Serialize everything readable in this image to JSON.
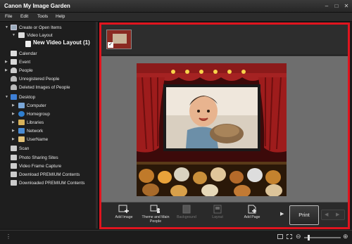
{
  "app": {
    "title": "Canon My Image Garden"
  },
  "window_controls": {
    "minimize": "–",
    "maximize": "□",
    "close": "✕"
  },
  "menu": [
    "File",
    "Edit",
    "Tools",
    "Help"
  ],
  "sidebar": {
    "items": [
      {
        "label": "Create or Open Items",
        "expanded": true,
        "icon": "create-icon"
      },
      {
        "label": "Video Layout",
        "expanded": true,
        "icon": "video-layout-icon"
      },
      {
        "label": "New Video Layout (1)",
        "selected": true,
        "icon": "document-icon"
      },
      {
        "label": "Calendar",
        "icon": "calendar-icon"
      },
      {
        "label": "Event",
        "icon": "event-icon"
      },
      {
        "label": "People",
        "icon": "people-icon"
      },
      {
        "label": "Unregistered People",
        "icon": "unregistered-people-icon"
      },
      {
        "label": "Deleted Images of People",
        "icon": "deleted-people-icon"
      },
      {
        "label": "Desktop",
        "expanded": true,
        "icon": "desktop-icon"
      },
      {
        "label": "Computer",
        "icon": "computer-icon"
      },
      {
        "label": "Homegroup",
        "icon": "homegroup-icon"
      },
      {
        "label": "Libraries",
        "icon": "libraries-icon"
      },
      {
        "label": "Network",
        "icon": "network-icon"
      },
      {
        "label": "UserName",
        "icon": "user-folder-icon"
      },
      {
        "label": "Scan",
        "icon": "scan-icon"
      },
      {
        "label": "Photo Sharing Sites",
        "icon": "photo-sharing-icon"
      },
      {
        "label": "Video Frame Capture",
        "icon": "video-frame-icon"
      },
      {
        "label": "Download PREMIUM Contents",
        "icon": "download-icon"
      },
      {
        "label": "Downloaded PREMIUM Contents",
        "icon": "downloaded-icon"
      }
    ]
  },
  "thumbnail": {
    "checked": true,
    "check_glyph": "✓"
  },
  "toolbar": {
    "add_image": "Add Image",
    "theme": "Theme and Main People",
    "background": "Background",
    "layout": "Layout",
    "add_page": "Add Page",
    "print": "Print",
    "more": "▶",
    "prev": "◀",
    "next": "▶"
  },
  "colors": {
    "accent_red": "#e0141e",
    "curtain": "#8b1a1a"
  }
}
